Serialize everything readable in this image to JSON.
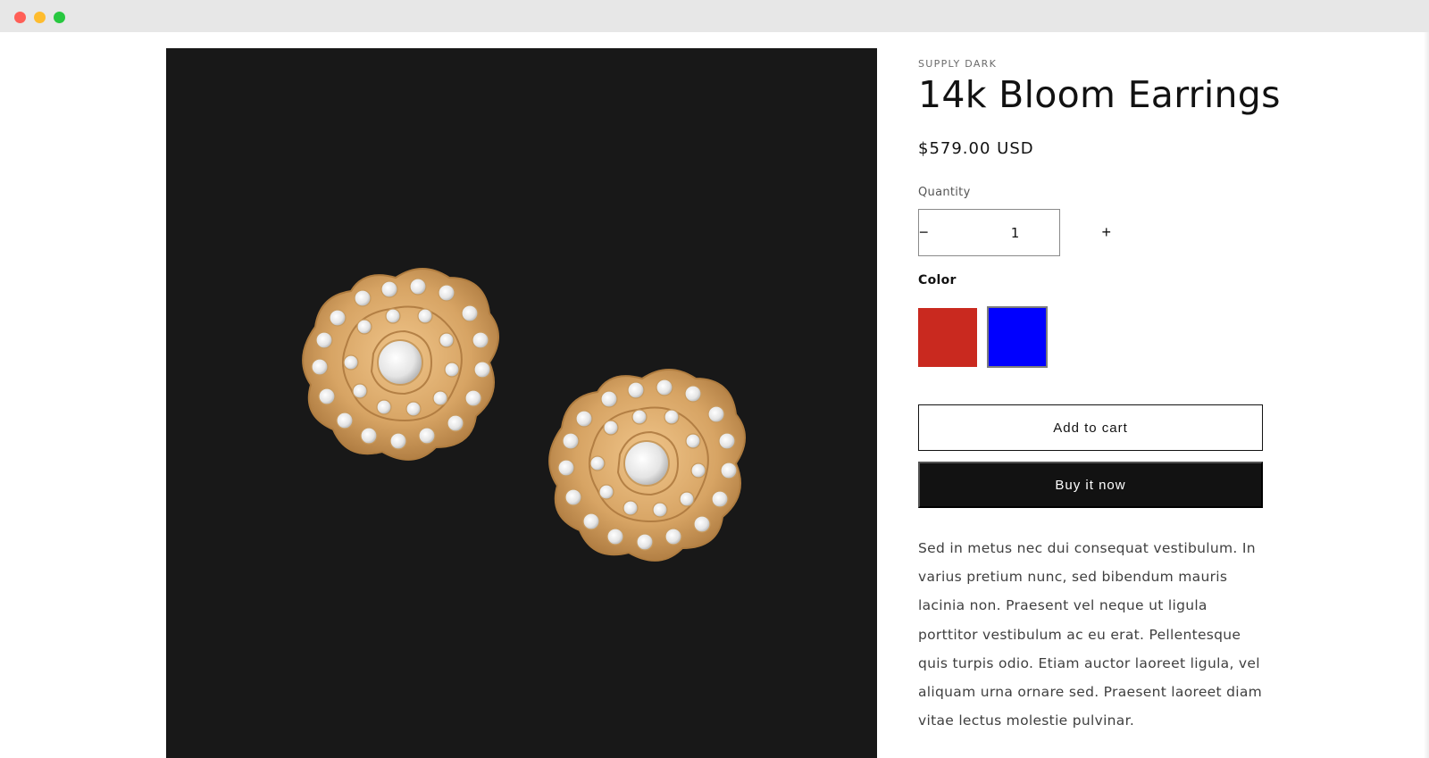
{
  "window": {
    "controls": [
      "close",
      "minimize",
      "maximize"
    ]
  },
  "product": {
    "vendor": "SUPPLY DARK",
    "title": "14k Bloom Earrings",
    "price": "$579.00 USD",
    "quantity": {
      "label": "Quantity",
      "decrease_icon": "minus-icon",
      "increase_icon": "plus-icon",
      "decrease_symbol": "−",
      "increase_symbol": "+",
      "value": "1"
    },
    "color": {
      "label": "Color",
      "options": [
        {
          "name": "red",
          "hex": "#c9291f",
          "selected": false
        },
        {
          "name": "blue",
          "hex": "#0000ff",
          "selected": true
        }
      ]
    },
    "add_to_cart_label": "Add to cart",
    "buy_now_label": "Buy it now",
    "description": "Sed in metus nec dui consequat vestibulum. In varius pretium nunc, sed bibendum mauris lacinia non. Praesent vel neque ut ligula porttitor vestibulum ac eu erat. Pellentesque quis turpis odio. Etiam auctor laoreet ligula, vel aliquam urna ornare sed. Praesent laoreet diam vitae lectus molestie pulvinar."
  },
  "media": {
    "background": "#181818",
    "metal_color": "#d7a464",
    "stone_color": "#f1f1f1"
  }
}
